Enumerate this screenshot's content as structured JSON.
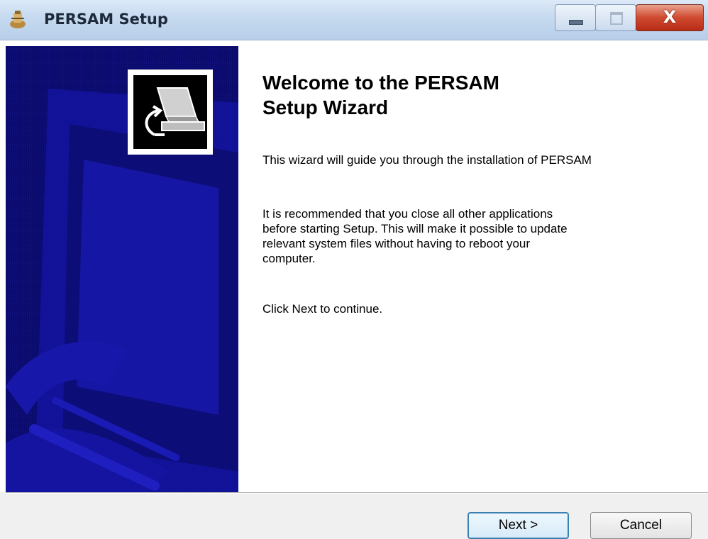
{
  "window": {
    "title": "PERSAM Setup",
    "controls": {
      "minimize_icon": "minimize-icon",
      "maximize_icon": "maximize-icon",
      "close_glyph": "X"
    }
  },
  "welcome": {
    "title_line1": "Welcome to the PERSAM",
    "title_line2": "Setup Wizard",
    "paragraph1": "This wizard will guide you through the installation of PERSAM",
    "paragraph2_line1": "It is recommended that you close all other applications",
    "paragraph2_line2": "before starting Setup. This will make it possible to update",
    "paragraph2_line3": "relevant system files without having to reboot your",
    "paragraph2_line4": "computer.",
    "paragraph3": "Click Next to continue."
  },
  "buttons": {
    "next_label": "Next >",
    "cancel_label": "Cancel"
  },
  "colors": {
    "side_panel": "#0b0b6e",
    "side_panel_pattern": "#1a1ab0",
    "next_border": "#3c7fb1"
  }
}
